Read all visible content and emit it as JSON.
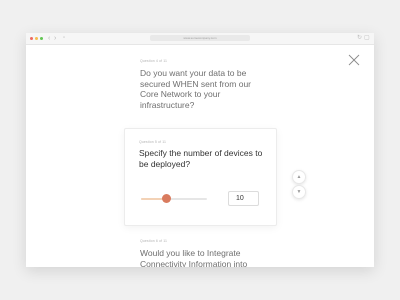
{
  "browser": {
    "url": "www.somecompany.com",
    "back_icon": "chevron-left-icon",
    "forward_icon": "chevron-right-icon"
  },
  "questions": [
    {
      "label": "Question 4 of 11",
      "text": "Do you want your data to be secured WHEN sent from our Core Network to your infrastructure?"
    },
    {
      "label": "Question 5 of 11",
      "text": "Specify the number of devices to be deployed?",
      "value": "10",
      "slider_fraction": 0.38
    },
    {
      "label": "Question 6 of 11",
      "text": "Would you like to Integrate Connectivity Information into"
    }
  ],
  "colors": {
    "accent": "#d97b5e",
    "slider_fill": "#f3d2b6",
    "text_dim": "#6f6f6f",
    "text_active": "#333333"
  }
}
